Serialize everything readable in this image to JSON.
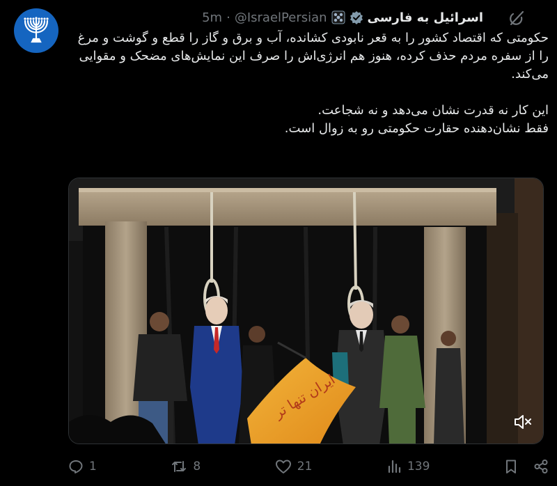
{
  "post": {
    "author_name": "اسرائیل به فارسی",
    "handle": "@IsraelPersian",
    "separator": "·",
    "time": "5m",
    "body_paragraphs": [
      "حکومتی که اقتصاد کشور را به قعر نابودی کشانده، آب و برق و گاز را قطع و گوشت و مرغ را از سفره مردم حذف کرده، هنوز هم انرژی‌اش را صرف این نمایش‌های مضحک و مقوایی می‌کند.",
      "این کار نه قدرت نشان می‌دهد و نه شجاعت.",
      "فقط نشان‌دهنده حقارت حکومتی رو به زوال است."
    ]
  },
  "media": {
    "flag_text": "ایران تنها تر"
  },
  "actions": {
    "replies": "1",
    "reposts": "8",
    "likes": "21",
    "views": "139"
  },
  "colors": {
    "background": "#000000",
    "text": "#e7e9ea",
    "secondary": "#71767b",
    "avatar": "#1565c0",
    "verified_badge": "#829aab"
  },
  "icons": [
    "grok-icon",
    "verified-badge-icon",
    "affiliate-badge-icon",
    "reply-icon",
    "repost-icon",
    "like-icon",
    "views-icon",
    "bookmark-icon",
    "share-icon",
    "mute-icon",
    "menorah-icon"
  ]
}
